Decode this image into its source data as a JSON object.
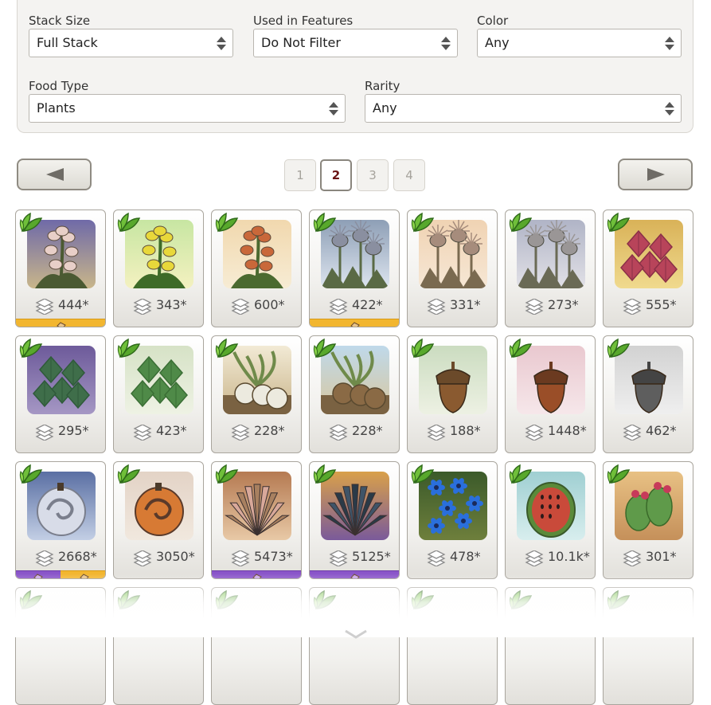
{
  "filters": {
    "stack_size": {
      "label": "Stack Size",
      "value": "Full Stack"
    },
    "used_in_features": {
      "label": "Used in Features",
      "value": "Do Not Filter"
    },
    "color": {
      "label": "Color",
      "value": "Any"
    },
    "food_type": {
      "label": "Food Type",
      "value": "Plants"
    },
    "rarity": {
      "label": "Rarity",
      "value": "Any"
    }
  },
  "pagination": {
    "pages": [
      "1",
      "2",
      "3",
      "4"
    ],
    "current": "2",
    "prev_icon": "left-triangle-icon",
    "next_icon": "right-triangle-icon"
  },
  "items": [
    {
      "count": "444*",
      "art": "lavender-flower",
      "feature": "gold"
    },
    {
      "count": "343*",
      "art": "yellow-flower",
      "feature": null
    },
    {
      "count": "600*",
      "art": "orange-flower",
      "feature": null
    },
    {
      "count": "422*",
      "art": "blue-thistle",
      "feature": "gold"
    },
    {
      "count": "331*",
      "art": "tan-thistle",
      "feature": null
    },
    {
      "count": "273*",
      "art": "gray-thistle",
      "feature": null
    },
    {
      "count": "555*",
      "art": "red-leaf",
      "feature": null
    },
    {
      "count": "295*",
      "art": "purple-mint",
      "feature": null
    },
    {
      "count": "423*",
      "art": "green-mint",
      "feature": null
    },
    {
      "count": "228*",
      "art": "white-turnip",
      "feature": null
    },
    {
      "count": "228*",
      "art": "brown-turnip",
      "feature": null
    },
    {
      "count": "188*",
      "art": "acorn",
      "feature": null
    },
    {
      "count": "1448*",
      "art": "red-acorn",
      "feature": null
    },
    {
      "count": "462*",
      "art": "gray-acorn",
      "feature": null
    },
    {
      "count": "2668*",
      "art": "gray-swirl-gourd",
      "feature": "purple-gold"
    },
    {
      "count": "3050*",
      "art": "orange-swirl-gourd",
      "feature": null
    },
    {
      "count": "5473*",
      "art": "tan-agave",
      "feature": "purple"
    },
    {
      "count": "5125*",
      "art": "blue-agave",
      "feature": "purple"
    },
    {
      "count": "478*",
      "art": "blue-flowers",
      "feature": null
    },
    {
      "count": "10.1k*",
      "art": "melon",
      "feature": null
    },
    {
      "count": "301*",
      "art": "prickly-pear",
      "feature": null
    }
  ],
  "icons": {
    "item_badge": "green-leaf-icon",
    "count_icon": "stack-layers-icon",
    "scroll_hint": "chevron-down-icon"
  },
  "colors": {
    "gold_feature": "#f2b630",
    "purple_feature": "#8a55c9",
    "current_page": "#6b1414"
  }
}
